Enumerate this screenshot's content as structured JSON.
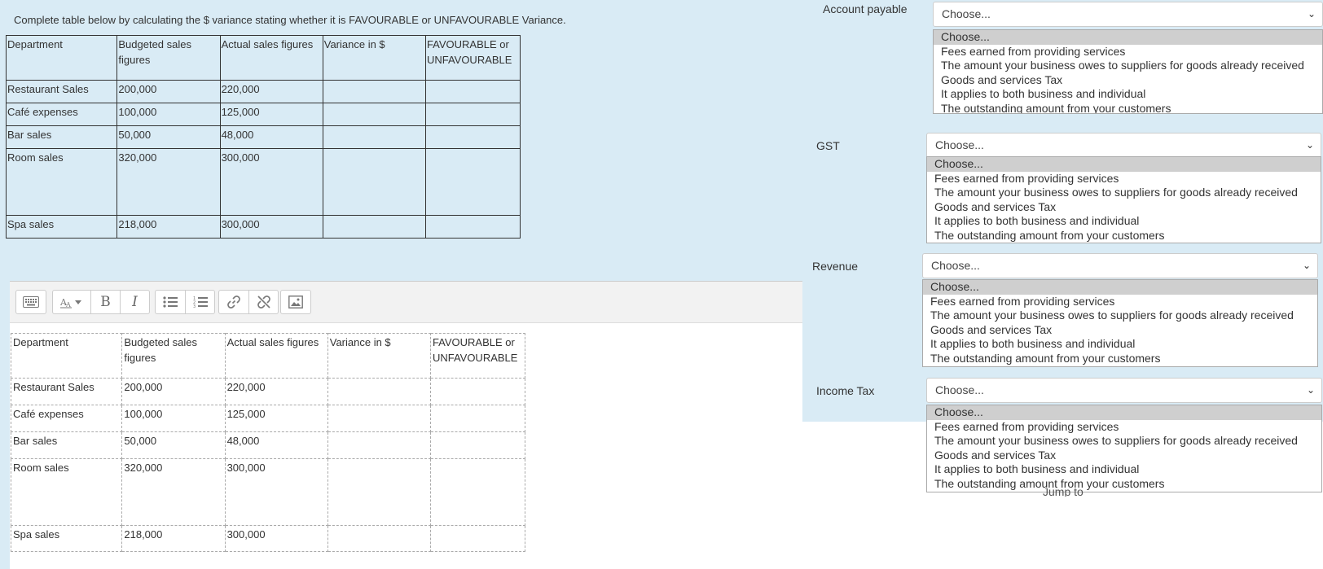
{
  "instruction": "Complete table below by calculating the $ variance stating whether it is FAVOURABLE or UNFAVOURABLE Variance.",
  "table": {
    "headers": [
      "Department",
      "Budgeted sales figures",
      "Actual sales figures",
      "Variance in $",
      "FAVOURABLE or UNFAVOURABLE"
    ],
    "rows": [
      [
        "Restaurant Sales",
        "200,000",
        "220,000",
        "",
        ""
      ],
      [
        "Café expenses",
        "100,000",
        "125,000",
        "",
        ""
      ],
      [
        "Bar sales",
        "50,000",
        "48,000",
        "",
        ""
      ],
      [
        "Room sales",
        "320,000",
        "300,000",
        "",
        ""
      ],
      [
        "Spa sales",
        "218,000",
        "300,000",
        "",
        ""
      ]
    ]
  },
  "editor": {
    "toolbar": [
      "keyboard-icon",
      "font-size-icon",
      "bold-icon",
      "italic-icon",
      "bullet-list-icon",
      "numbered-list-icon",
      "link-icon",
      "unlink-icon",
      "image-icon"
    ],
    "bold_glyph": "B",
    "italic_glyph": "I"
  },
  "matching": [
    {
      "term": "Account payable",
      "selected": "Choose...",
      "options": [
        "Choose...",
        "Fees earned from providing services",
        "The amount your business owes to suppliers for goods already received",
        "Goods and services Tax",
        "It applies to both business and individual",
        "The outstanding amount from your customers"
      ]
    },
    {
      "term": "GST",
      "selected": "Choose...",
      "options": [
        "Choose...",
        "Fees earned from providing services",
        "The amount your business owes to suppliers for goods already received",
        "Goods and services Tax",
        "It applies to both business and individual",
        "The outstanding amount from your customers"
      ]
    },
    {
      "term": "Revenue",
      "selected": "Choose...",
      "options": [
        "Choose...",
        "Fees earned from providing services",
        "The amount your business owes to suppliers for goods already received",
        "Goods and services Tax",
        "It applies to both business and individual",
        "The outstanding amount from your customers"
      ]
    },
    {
      "term": "Income Tax",
      "selected": "Choose...",
      "options": [
        "Choose...",
        "Fees earned from providing services",
        "The amount your business owes to suppliers for goods already received",
        "Goods and services Tax",
        "It applies to both business and individual",
        "The outstanding amount from your customers"
      ]
    }
  ],
  "footer_partial": "Jump to"
}
